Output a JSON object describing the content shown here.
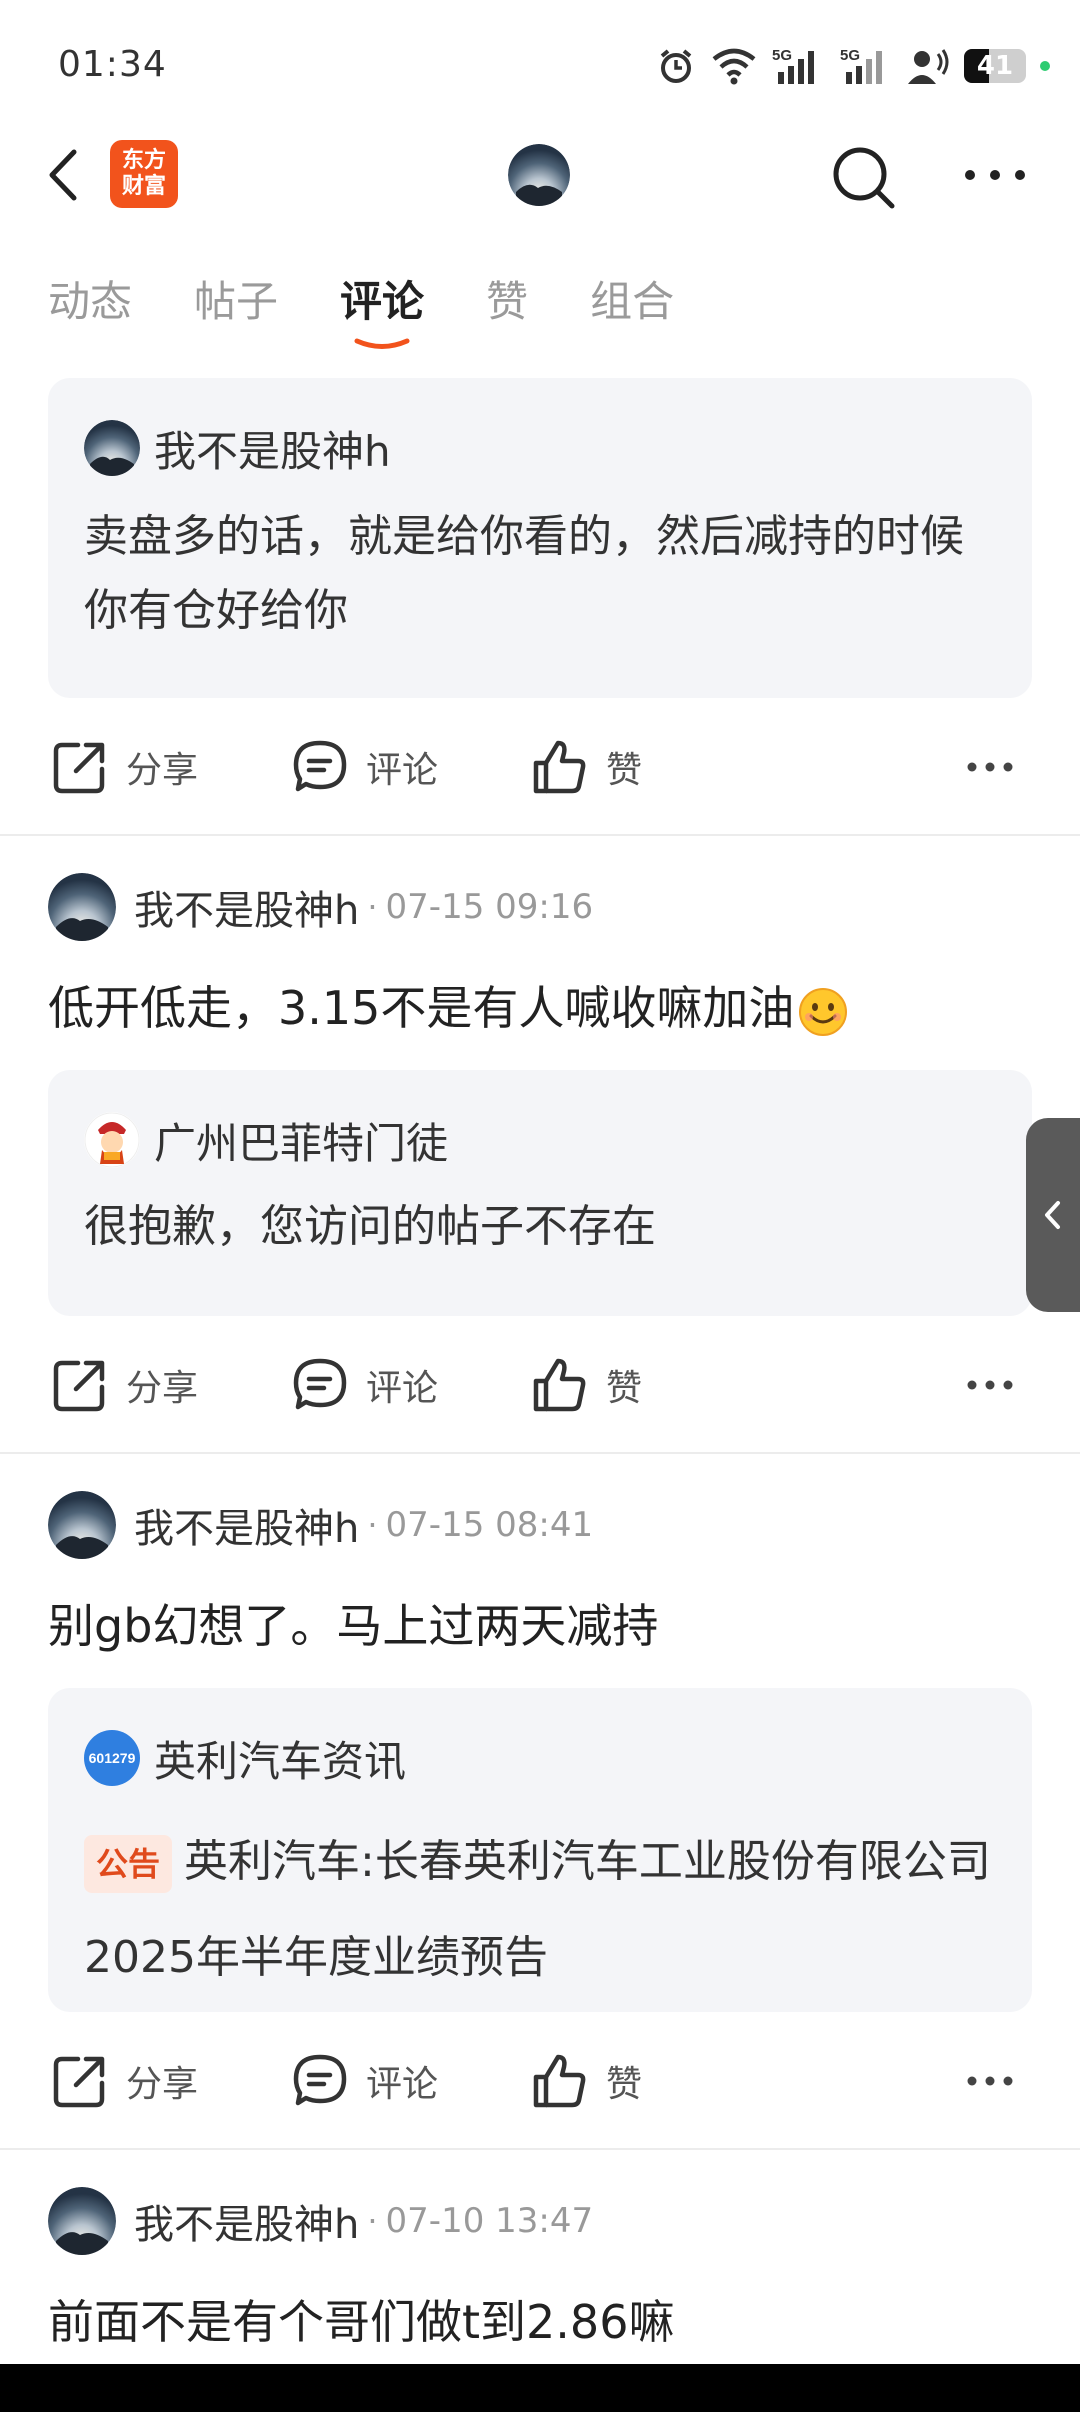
{
  "status_bar": {
    "time": "01:34",
    "battery": "41",
    "battery_level": 0.41
  },
  "header": {
    "logo_line1": "东方",
    "logo_line2": "财富"
  },
  "tabs": [
    {
      "label": "动态"
    },
    {
      "label": "帖子"
    },
    {
      "label": "评论"
    },
    {
      "label": "赞"
    },
    {
      "label": "组合"
    }
  ],
  "active_tab": "评论",
  "actions": {
    "share": "分享",
    "comment": "评论",
    "like": "赞"
  },
  "items": [
    {
      "quote": {
        "user": "我不是股神h",
        "text": "卖盘多的话，就是给你看的，然后减持的时候你有仓好给你"
      }
    },
    {
      "user": "我不是股神h",
      "time": "07-15 09:16",
      "text": "低开低走，3.15不是有人喊收嘛加油",
      "quote": {
        "user": "广州巴菲特门徒",
        "text": "很抱歉，您访问的帖子不存在"
      }
    },
    {
      "user": "我不是股神h",
      "time": "07-15 08:41",
      "text": "别gb幻想了。马上过两天减持",
      "quote": {
        "user": "英利汽车资讯",
        "avatar_text": "601279",
        "badge": "公告",
        "text": "英利汽车:长春英利汽车工业股份有限公司2025年半年度业绩预告"
      }
    },
    {
      "user": "我不是股神h",
      "time": "07-10 13:47",
      "text": "前面不是有个哥们做t到2.86嘛"
    }
  ],
  "colors": {
    "accent": "#f2531c",
    "quote_bg": "#f4f5f8",
    "badge_text": "#e04a1c"
  }
}
